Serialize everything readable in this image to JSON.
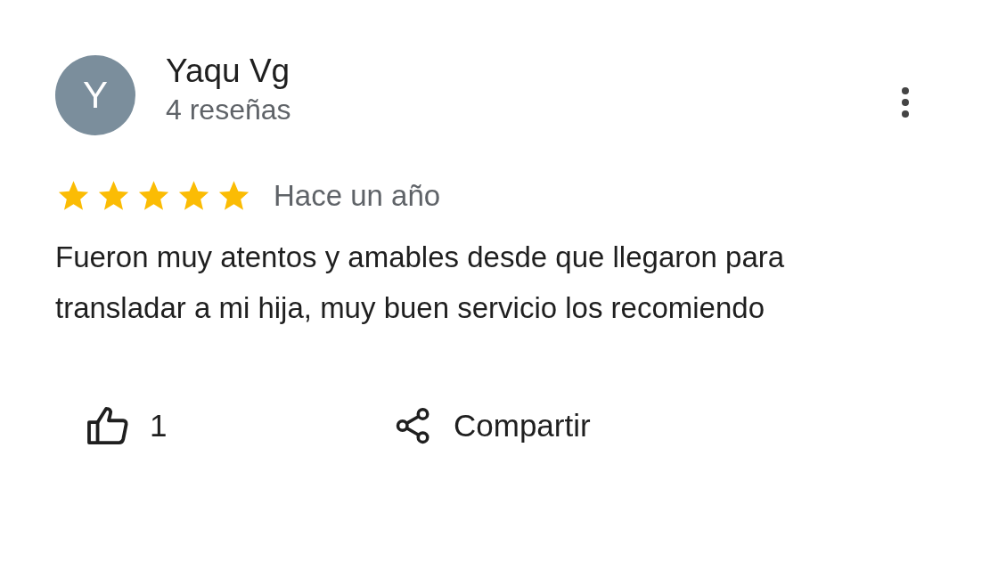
{
  "review": {
    "avatar_letter": "Y",
    "author": "Yaqu Vg",
    "review_count": "4 reseñas",
    "stars": 5,
    "time": "Hace un año",
    "text": "Fueron muy atentos y amables desde que llegaron para transladar a mi hija, muy buen servicio los recomiendo"
  },
  "actions": [
    {
      "kind": "like",
      "label": "1"
    },
    {
      "kind": "share",
      "label": "Compartir"
    }
  ]
}
